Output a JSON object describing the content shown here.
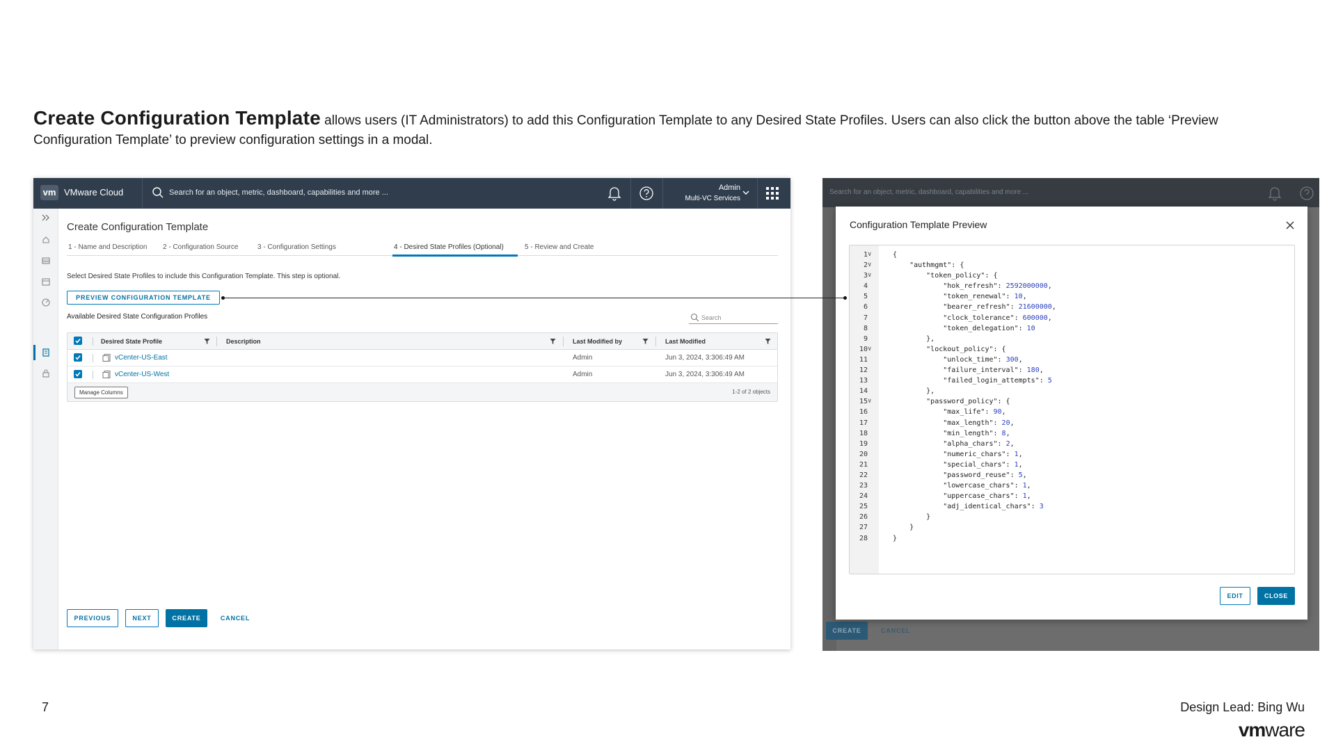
{
  "slide": {
    "title_bold": "Create Configuration Template",
    "title_rest": " allows users (IT Administrators) to add this Configuration Template to any Desired State Profiles. Users can also click the button above the table ‘Preview Configuration Template’ to preview configuration settings in a modal.",
    "page_number": "7",
    "design_lead": "Design Lead: Bing Wu",
    "logo_bold": "vm",
    "logo_thin": "ware"
  },
  "app": {
    "logo": "vm",
    "brand": "VMware Cloud",
    "search_placeholder": "Search for an object, metric, dashboard, capabilities and more ...",
    "user_name": "Admin",
    "user_org": "Multi-VC Services",
    "page_title": "Create Configuration Template",
    "steps": [
      "1 - Name and Description",
      "2 - Configuration Source",
      "3 - Configuration Settings",
      "4 - Desired State Profiles (Optional)",
      "5 - Review and Create"
    ],
    "active_step": 3,
    "step_description": "Select Desired State Profiles to include this Configuration Template. This step is optional.",
    "preview_button": "PREVIEW CONFIGURATION TEMPLATE",
    "available_title": "Available Desired State Configuration Profiles",
    "table_search_placeholder": "Search",
    "table": {
      "columns": [
        "Desired State Profile",
        "Description",
        "Last Modified by",
        "Last Modified"
      ],
      "rows": [
        {
          "profile": "vCenter-US-East",
          "description": "",
          "modified_by": "Admin",
          "modified": "Jun 3, 2024, 3:306:49 AM",
          "checked": true
        },
        {
          "profile": "vCenter-US-West",
          "description": "",
          "modified_by": "Admin",
          "modified": "Jun 3, 2024, 3:306:49 AM",
          "checked": true
        }
      ],
      "manage_columns": "Manage Columns",
      "count": "1-2 of 2 objects"
    },
    "buttons": {
      "previous": "PREVIOUS",
      "next": "NEXT",
      "create": "CREATE",
      "cancel": "CANCEL"
    }
  },
  "modal": {
    "background_search": "Search for an object, metric, dashboard, capabilities and more ...",
    "title": "Configuration Template Preview",
    "edit": "EDIT",
    "close": "CLOSE",
    "bg_create": "CREATE",
    "bg_cancel": "CANCEL",
    "code_lines": [
      "{",
      "    \"authmgmt\": {",
      "        \"token_policy\": {",
      "            \"hok_refresh\": 2592000000,",
      "            \"token_renewal\": 10,",
      "            \"bearer_refresh\": 21600000,",
      "            \"clock_tolerance\": 600000,",
      "            \"token_delegation\": 10",
      "        },",
      "        \"lockout_policy\": {",
      "            \"unlock_time\": 300,",
      "            \"failure_interval\": 180,",
      "            \"failed_login_attempts\": 5",
      "        },",
      "        \"password_policy\": {",
      "            \"max_life\": 90,",
      "            \"max_length\": 20,",
      "            \"min_length\": 8,",
      "            \"alpha_chars\": 2,",
      "            \"numeric_chars\": 1,",
      "            \"special_chars\": 1,",
      "            \"password_reuse\": 5,",
      "            \"lowercase_chars\": 1,",
      "            \"uppercase_chars\": 1,",
      "            \"adj_identical_chars\": 3",
      "        }",
      "    }",
      "}"
    ],
    "foldable_lines": [
      1,
      2,
      3,
      10,
      15
    ]
  },
  "colors": {
    "accent": "#0072a3",
    "topbar": "#2f3d4d"
  }
}
